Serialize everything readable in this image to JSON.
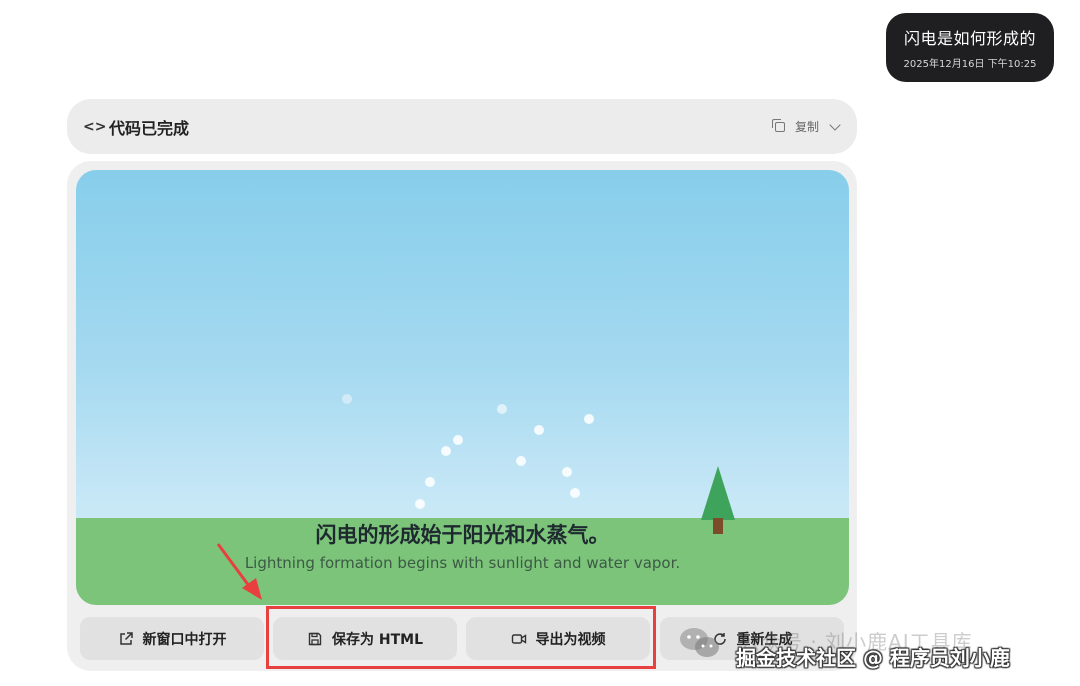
{
  "user_message": {
    "text": "闪电是如何形成的",
    "timestamp": "2025年12月16日 下午10:25"
  },
  "code_bar": {
    "icon": "code-brackets-icon",
    "title": "代码已完成",
    "copy_label": "复制"
  },
  "preview": {
    "caption_zh": "闪电的形成始于阳光和水蒸气。",
    "caption_en": "Lightning formation begins with sunlight and water vapor."
  },
  "actions": {
    "open_new_window": "新窗口中打开",
    "save_html": "保存为 HTML",
    "export_video": "导出为视频",
    "regenerate": "重新生成"
  },
  "watermark": {
    "text_back": "公众号 · 刘小鹿AI工具库",
    "text_front": "掘金技术社区 @ 程序员刘小鹿"
  },
  "colors": {
    "highlight": "#e8403f",
    "sky": "#87ceeb",
    "ground": "#7bc47a",
    "tree": "#3fa45b"
  }
}
